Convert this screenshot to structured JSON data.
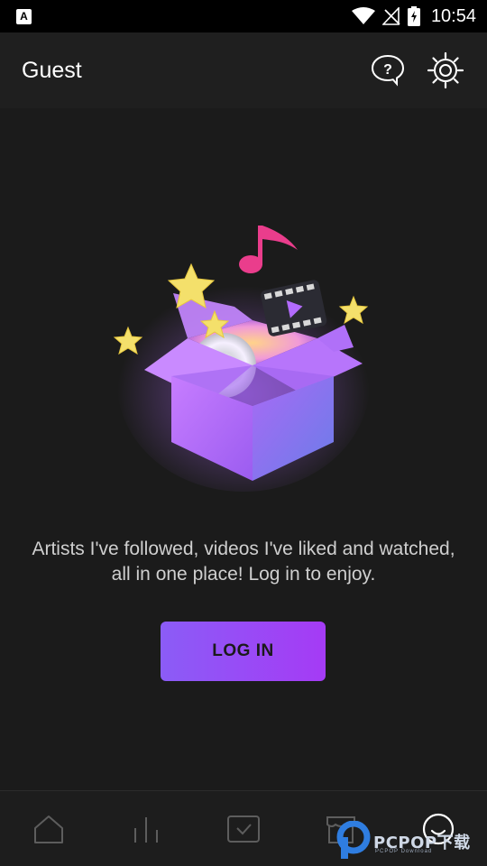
{
  "status_bar": {
    "time": "10:54",
    "notification_letter": "A",
    "icons": [
      "wifi-icon",
      "no-signal-icon",
      "battery-charging-icon"
    ]
  },
  "header": {
    "title": "Guest",
    "actions": [
      "help-icon",
      "settings-icon"
    ]
  },
  "main": {
    "illustration": "gift-box-with-music-video-cd-stars",
    "message": "Artists I've followed, videos I've liked and watched, all in one place! Log in to enjoy.",
    "login_label": "LOG IN"
  },
  "bottom_nav": {
    "tabs": [
      "home-icon",
      "chart-icon",
      "inbox-icon",
      "shop-icon",
      "profile-icon"
    ],
    "selected": "profile-icon"
  },
  "watermark": {
    "text": "PCPOP下载",
    "sub": "PCPOP Download"
  },
  "colors": {
    "background": "#1b1b1b",
    "accent_start": "#8b5cf6",
    "accent_end": "#a53bf5",
    "text_secondary": "#cfcfcf"
  }
}
